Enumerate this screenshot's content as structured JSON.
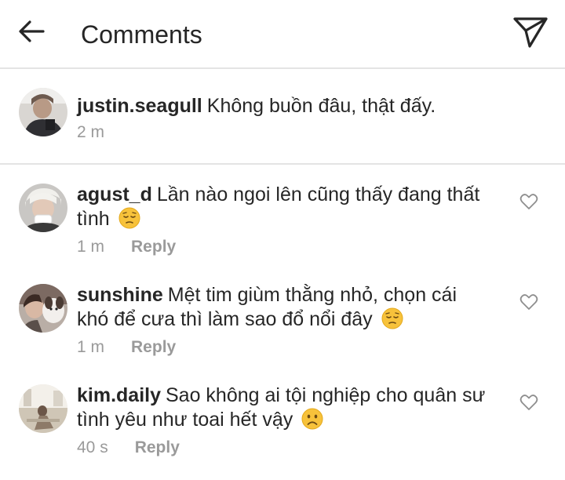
{
  "header": {
    "title": "Comments",
    "back_icon": "arrow-left-icon",
    "share_icon": "send-paper-plane-icon"
  },
  "caption": {
    "username": "justin.seagull",
    "text": "Không buồn đâu, thật đấy.",
    "time": "2 m"
  },
  "comments": [
    {
      "username": "agust_d",
      "text": "Lần nào ngoi lên cũng thấy đang thất tình",
      "emoji": "pensive-face-icon",
      "time": "1 m",
      "reply_label": "Reply"
    },
    {
      "username": "sunshine",
      "text": "Mệt tim giùm thằng nhỏ, chọn cái khó để cưa thì làm sao đổ nổi đây",
      "emoji": "pensive-face-icon",
      "time": "1 m",
      "reply_label": "Reply"
    },
    {
      "username": "kim.daily",
      "text": "Sao không ai tội nghiệp cho quân sư tình yêu như toai hết vậy",
      "emoji": "frowning-face-icon",
      "time": "40 s",
      "reply_label": "Reply"
    }
  ],
  "colors": {
    "text": "#262626",
    "secondary": "#9a9a9a",
    "divider": "#e4e4e4",
    "emoji": "#f7c23b"
  }
}
